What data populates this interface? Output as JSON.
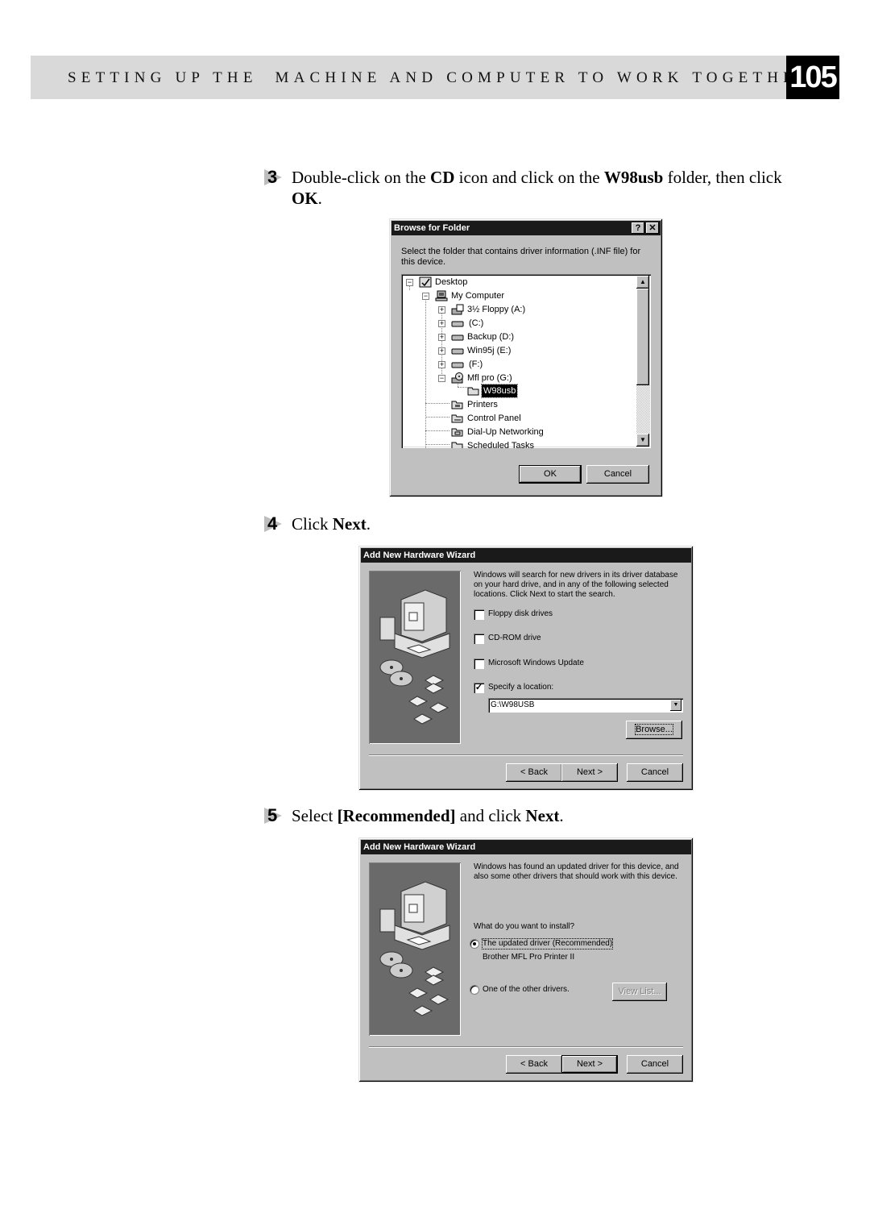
{
  "header": {
    "section_title": "SETTING UP THE  MACHINE AND COMPUTER TO WORK TOGETHER",
    "page_number": "105"
  },
  "steps": [
    {
      "number": "3",
      "parts": [
        "Double-click on the ",
        "CD",
        " icon and click on the ",
        "W98usb",
        " folder, then click ",
        "OK",
        "."
      ]
    },
    {
      "number": "4",
      "parts": [
        "Click ",
        "Next",
        "."
      ]
    },
    {
      "number": "5",
      "parts": [
        "Select ",
        "[Recommended]",
        " and click ",
        "Next",
        "."
      ]
    }
  ],
  "browse_dialog": {
    "title": "Browse for Folder",
    "help_button": "?",
    "close_button": "✕",
    "description": "Select the folder that contains driver information (.INF file) for this device.",
    "tree": [
      {
        "label": "Desktop",
        "icon": "desktop-icon",
        "expander": "−"
      },
      {
        "label": "My Computer",
        "icon": "computer-icon",
        "expander": "−"
      },
      {
        "label": "3½ Floppy (A:)",
        "icon": "floppy-drive-icon",
        "expander": "+"
      },
      {
        "label": "(C:)",
        "icon": "hard-drive-icon",
        "expander": "+"
      },
      {
        "label": "Backup (D:)",
        "icon": "hard-drive-icon",
        "expander": "+"
      },
      {
        "label": "Win95j (E:)",
        "icon": "hard-drive-icon",
        "expander": "+"
      },
      {
        "label": "(F:)",
        "icon": "hard-drive-icon",
        "expander": "+"
      },
      {
        "label": "Mfl pro (G:)",
        "icon": "cd-drive-icon",
        "expander": "−"
      },
      {
        "label": "W98usb",
        "icon": "folder-icon",
        "selected": true
      },
      {
        "label": "Printers",
        "icon": "printers-folder-icon"
      },
      {
        "label": "Control Panel",
        "icon": "control-panel-icon"
      },
      {
        "label": "Dial-Up Networking",
        "icon": "dialup-networking-icon"
      },
      {
        "label": "Scheduled Tasks",
        "icon": "scheduled-tasks-icon"
      }
    ],
    "ok_label": "OK",
    "cancel_label": "Cancel"
  },
  "wizard1": {
    "title": "Add New Hardware Wizard",
    "description": "Windows will search for new drivers in its driver database on your hard drive, and in any of the following selected locations. Click Next to start the search.",
    "options": [
      {
        "label": "Floppy disk drives",
        "accel": "F",
        "checked": false
      },
      {
        "label": "CD-ROM drive",
        "accel": "C",
        "checked": false
      },
      {
        "label": "Microsoft Windows Update",
        "accel": "M",
        "checked": false
      },
      {
        "label": "Specify a location:",
        "accel": "l",
        "checked": true
      }
    ],
    "location_value": "G:\\W98USB",
    "browse_label": "Browse...",
    "back_label": "< Back",
    "next_label": "Next >",
    "cancel_label": "Cancel"
  },
  "wizard2": {
    "title": "Add New Hardware Wizard",
    "description": "Windows has found an updated driver for this device, and also some other drivers that should work with this device.",
    "question": "What do you want to install?",
    "options": [
      {
        "label": "The updated driver (Recommended)",
        "sublabel": "Brother MFL Pro Printer II",
        "selected": true
      },
      {
        "label": "One of the other drivers.",
        "selected": false
      }
    ],
    "view_list_label": "View List...",
    "back_label": "< Back",
    "next_label": "Next >",
    "cancel_label": "Cancel"
  }
}
